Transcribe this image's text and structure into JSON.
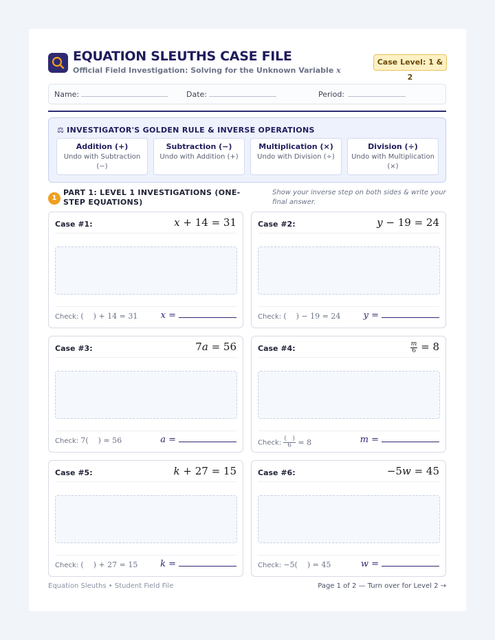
{
  "header": {
    "title": "EQUATION SLEUTHS CASE FILE",
    "subtitle": "Official Field Investigation: Solving for the Unknown Variable",
    "subtitle_var": "x",
    "badge": "Case Level: 1 & 2",
    "logo_icon": "magnifying-glass-icon"
  },
  "info": {
    "name_label": "Name:",
    "date_label": "Date:",
    "period_label": "Period:"
  },
  "rules": {
    "heading": "INVESTIGATOR'S GOLDEN RULE & INVERSE OPERATIONS",
    "heading_icon": "⚖",
    "ops": [
      {
        "name": "Addition (+)",
        "desc": "Undo with Subtraction (−)"
      },
      {
        "name": "Subtraction (−)",
        "desc": "Undo with Addition (+)"
      },
      {
        "name": "Multiplication (×)",
        "desc": "Undo with Division (÷)"
      },
      {
        "name": "Division (÷)",
        "desc": "Undo with Multiplication (×)"
      }
    ]
  },
  "part1": {
    "number": "1",
    "title": "PART 1: LEVEL 1 INVESTIGATIONS (ONE-STEP EQUATIONS)",
    "note": "Show your inverse step on both sides & write your final answer."
  },
  "check_label": "Check:",
  "cases": [
    {
      "label": "Case #1:",
      "variable": "x",
      "answer_label": "x ="
    },
    {
      "label": "Case #2:",
      "variable": "y",
      "answer_label": "y ="
    },
    {
      "label": "Case #3:",
      "variable": "a",
      "answer_label": "a ="
    },
    {
      "label": "Case #4:",
      "variable": "m",
      "answer_label": "m ="
    },
    {
      "label": "Case #5:",
      "variable": "k",
      "answer_label": "k ="
    },
    {
      "label": "Case #6:",
      "variable": "w",
      "answer_label": "w ="
    }
  ],
  "footer": {
    "left": "Equation Sleuths • Student Field File",
    "right": "Page 1 of 2 — Turn over for Level 2 →"
  },
  "colors": {
    "navy": "#2e2a72",
    "accent_orange": "#f0a020",
    "badge_bg": "#fdf0c4",
    "rule_bg": "#eef2fd"
  }
}
